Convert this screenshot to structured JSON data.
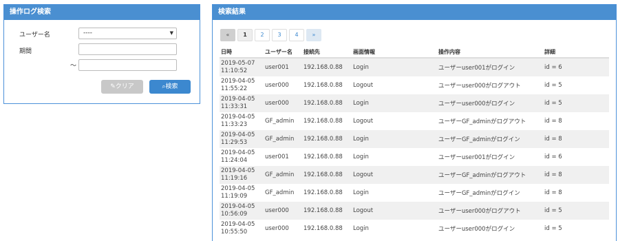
{
  "search_panel": {
    "title": "操作ログ検索",
    "user_label": "ユーザー名",
    "user_value": "----",
    "period_label": "期間",
    "tilde": "～",
    "clear_label": "クリア",
    "search_label": "検索"
  },
  "result_panel": {
    "title": "検索結果",
    "pager": {
      "prev": "«",
      "pages": [
        "1",
        "2",
        "3",
        "4"
      ],
      "next": "»"
    },
    "headers": [
      "日時",
      "ユーザー名",
      "接続先",
      "画面情報",
      "操作内容",
      "詳細"
    ],
    "rows": [
      {
        "date": "2019-05-07",
        "time": "11:10:52",
        "user": "user001",
        "host": "192.168.0.88",
        "screen": "Login",
        "op": "ユーザーuser001がログイン",
        "detail": "id = 6"
      },
      {
        "date": "2019-04-05",
        "time": "11:55:22",
        "user": "user000",
        "host": "192.168.0.88",
        "screen": "Logout",
        "op": "ユーザーuser000がログアウト",
        "detail": "id = 5"
      },
      {
        "date": "2019-04-05",
        "time": "11:33:31",
        "user": "user000",
        "host": "192.168.0.88",
        "screen": "Login",
        "op": "ユーザーuser000がログイン",
        "detail": "id = 5"
      },
      {
        "date": "2019-04-05",
        "time": "11:33:23",
        "user": "GF_admin",
        "host": "192.168.0.88",
        "screen": "Logout",
        "op": "ユーザーGF_adminがログアウト",
        "detail": "id = 8"
      },
      {
        "date": "2019-04-05",
        "time": "11:29:53",
        "user": "GF_admin",
        "host": "192.168.0.88",
        "screen": "Login",
        "op": "ユーザーGF_adminがログイン",
        "detail": "id = 8"
      },
      {
        "date": "2019-04-05",
        "time": "11:24:04",
        "user": "user001",
        "host": "192.168.0.88",
        "screen": "Login",
        "op": "ユーザーuser001がログイン",
        "detail": "id = 6"
      },
      {
        "date": "2019-04-05",
        "time": "11:19:16",
        "user": "GF_admin",
        "host": "192.168.0.88",
        "screen": "Logout",
        "op": "ユーザーGF_adminがログアウト",
        "detail": "id = 8"
      },
      {
        "date": "2019-04-05",
        "time": "11:19:09",
        "user": "GF_admin",
        "host": "192.168.0.88",
        "screen": "Login",
        "op": "ユーザーGF_adminがログイン",
        "detail": "id = 8"
      },
      {
        "date": "2019-04-05",
        "time": "10:56:09",
        "user": "user000",
        "host": "192.168.0.88",
        "screen": "Logout",
        "op": "ユーザーuser000がログアウト",
        "detail": "id = 5"
      },
      {
        "date": "2019-04-05",
        "time": "10:55:50",
        "user": "user000",
        "host": "192.168.0.88",
        "screen": "Login",
        "op": "ユーザーuser000がログイン",
        "detail": "id = 5"
      }
    ]
  }
}
